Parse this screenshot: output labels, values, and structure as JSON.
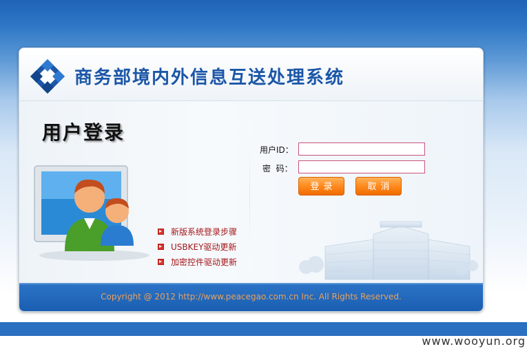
{
  "header": {
    "system_title": "商务部境内外信息互送处理系统"
  },
  "login": {
    "title": "用户登录",
    "user_label": "用户ID：",
    "password_label": "密  码：",
    "user_value": "",
    "password_value": "",
    "login_button": "登录",
    "cancel_button": "取消"
  },
  "links": [
    {
      "label": "新版系统登录步骤"
    },
    {
      "label": "USBKEY驱动更新"
    },
    {
      "label": "加密控件驱动更新"
    }
  ],
  "footer": {
    "copyright": "Copyright @ 2012 http://www.peacegao.com.cn Inc. All Rights Reserved."
  },
  "watermark": "www.wooyun.org",
  "colors": {
    "brand_blue": "#1b56a7",
    "button_orange": "#ff8a1e",
    "link_red": "#a3161b",
    "footer_blue": "#1a5db0"
  },
  "icons": [
    "logo-icon",
    "monitor-users-icon",
    "building-icon",
    "bullet-icon"
  ]
}
